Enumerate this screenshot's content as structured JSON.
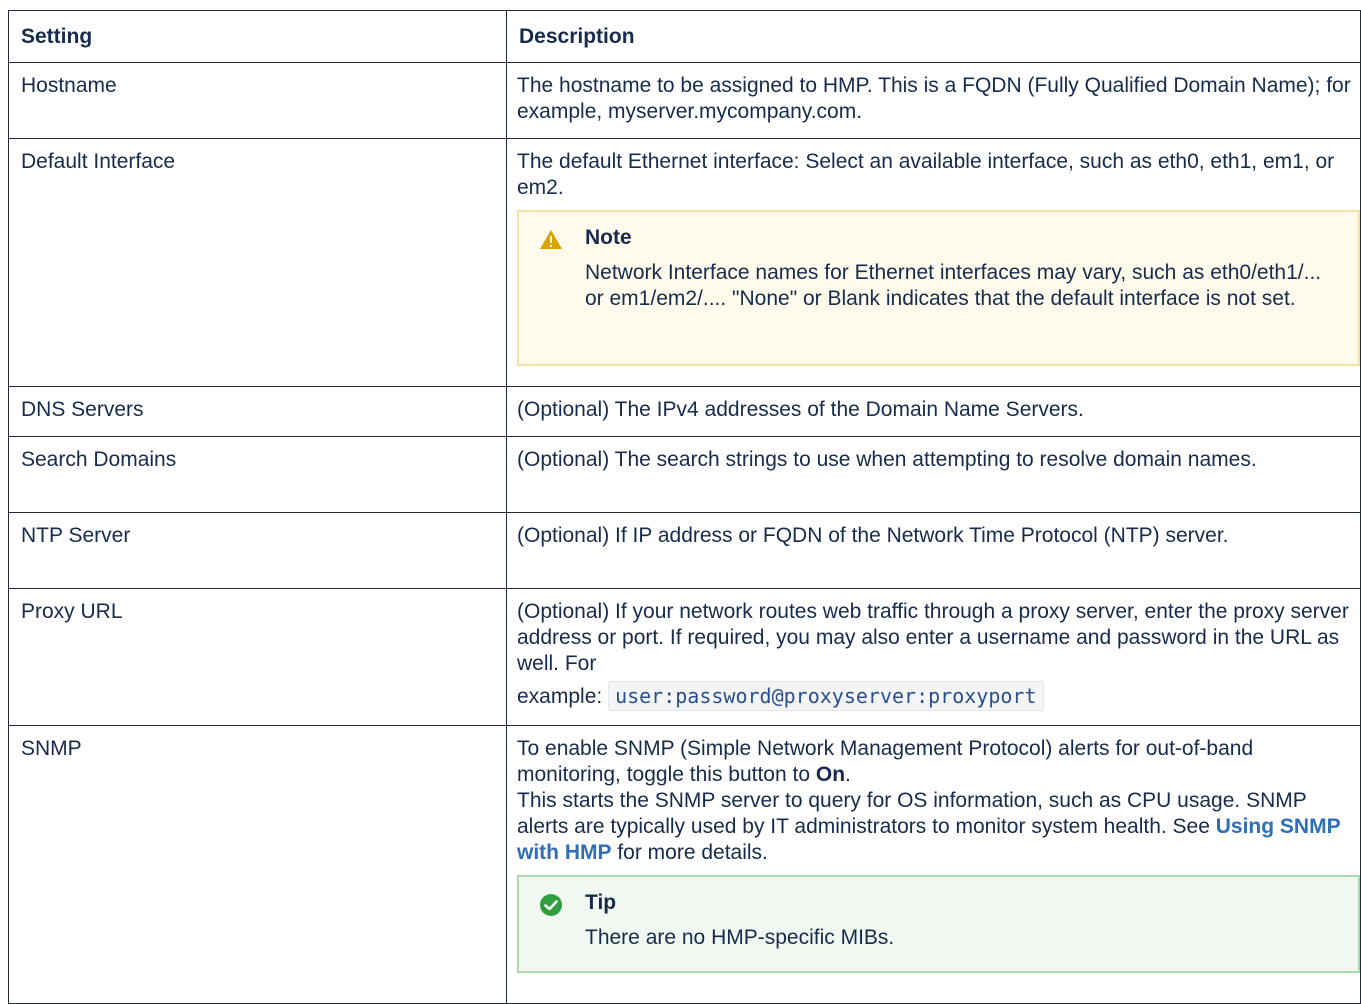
{
  "table": {
    "headers": [
      "Setting",
      "Description"
    ],
    "rows": {
      "hostname": {
        "setting": "Hostname",
        "description": "The hostname to be assigned to HMP. This is a FQDN (Fully Qualified Domain Name); for example, myserver.mycompany.com."
      },
      "default_interface": {
        "setting": "Default Interface",
        "description": "The default Ethernet interface: Select an available interface, such as eth0, eth1, em1, or em2.",
        "note": {
          "title": "Note",
          "body": "Network Interface names for Ethernet interfaces may vary, such as eth0/eth1/... or em1/em2/.... \"None\" or Blank indicates that the default interface is not set."
        }
      },
      "dns_servers": {
        "setting": "DNS Servers",
        "description": "(Optional) The IPv4 addresses of the Domain Name Servers."
      },
      "search_domains": {
        "setting": "Search Domains",
        "description": "(Optional) The search strings to use when attempting to resolve domain names."
      },
      "ntp_server": {
        "setting": "NTP Server",
        "description": "(Optional) If IP address or FQDN of the Network Time Protocol (NTP) server."
      },
      "proxy_url": {
        "setting": "Proxy URL",
        "description": "(Optional) If your network routes web traffic through a proxy server, enter the proxy server address or port. If required, you may also enter a username and password in the URL as well. For",
        "example_label": "example:",
        "example_code": "user:password@proxyserver:proxyport"
      },
      "snmp": {
        "setting": "SNMP",
        "description_pre": "To enable SNMP (Simple Network Management Protocol) alerts for out-of-band monitoring, toggle this button to ",
        "description_bold": "On",
        "description_post": ".",
        "description2_pre": "This starts the SNMP server to query for OS information, such as CPU usage. SNMP alerts are typically used by IT administrators to monitor system health. See ",
        "link_text": "Using SNMP with HMP",
        "description2_post": " for more details.",
        "tip": {
          "title": "Tip",
          "body": "There are no HMP-specific MIBs."
        }
      }
    }
  },
  "colors": {
    "note_border": "#f6e3a4",
    "note_bg": "#fffbec",
    "tip_border": "#a9d8a9",
    "tip_bg": "#f1f8f1",
    "link": "#2e6fb5",
    "warning_icon": "#d9a400",
    "success_icon": "#2e9e3f"
  },
  "icons": {
    "note": "warning-triangle-icon",
    "tip": "check-circle-icon"
  }
}
